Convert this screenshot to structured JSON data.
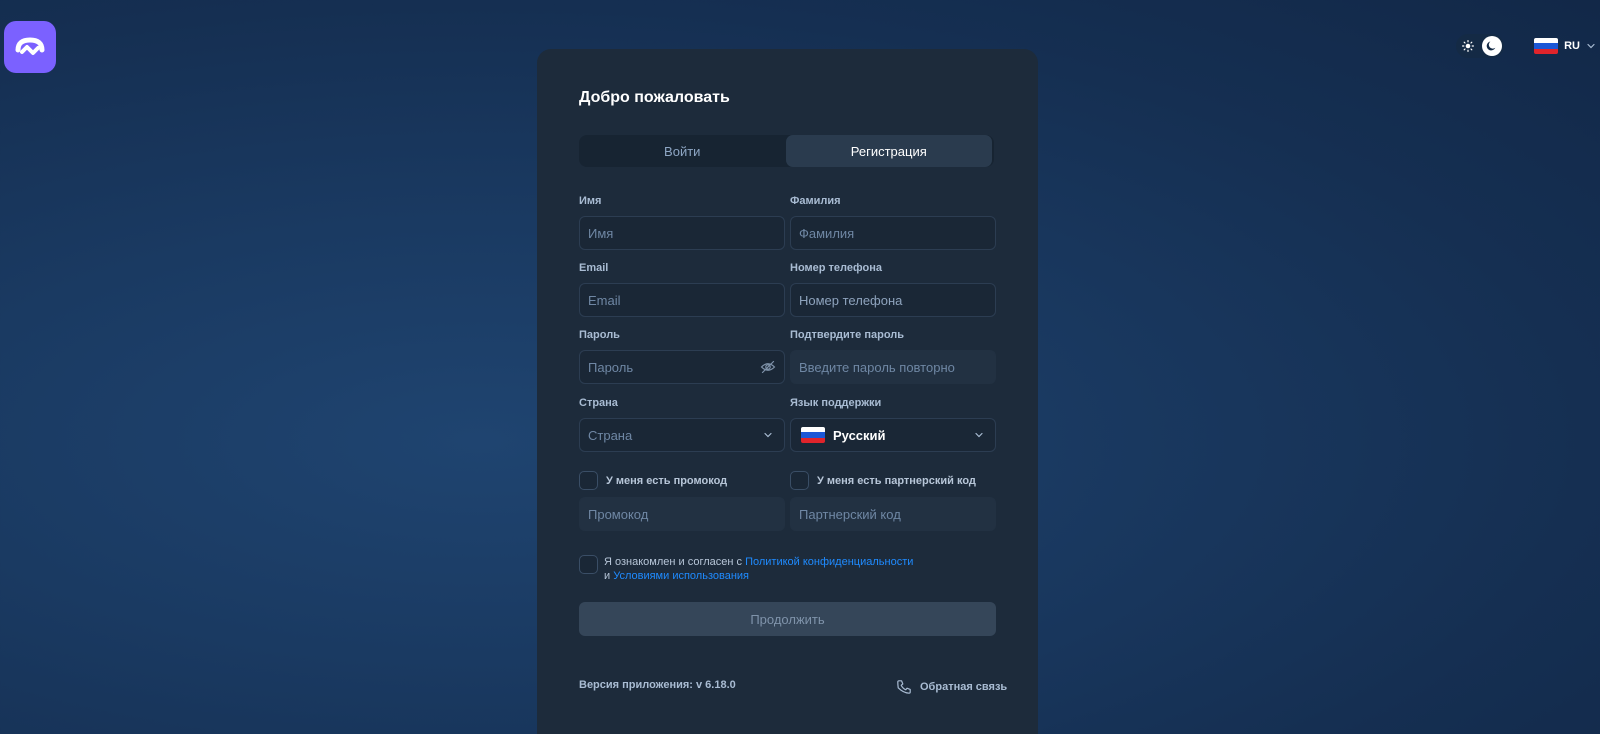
{
  "app": {
    "logo_icon": "app-logo-icon",
    "accent_color": "#7b61ff"
  },
  "topbar": {
    "theme_toggle": {
      "light_icon": "sun-icon",
      "dark_icon": "moon-icon",
      "active": "dark"
    },
    "language": {
      "code": "RU",
      "flag": "russia-flag-icon"
    }
  },
  "card": {
    "title": "Добро пожаловать",
    "tabs": [
      {
        "label": "Войти",
        "active": false
      },
      {
        "label": "Регистрация",
        "active": true
      }
    ],
    "fields": {
      "first_name": {
        "label": "Имя",
        "placeholder": "Имя",
        "value": ""
      },
      "last_name": {
        "label": "Фамилия",
        "placeholder": "Фамилия",
        "value": ""
      },
      "email": {
        "label": "Email",
        "placeholder": "Email",
        "value": ""
      },
      "phone": {
        "label": "Номер телефона",
        "placeholder": "Номер телефона",
        "value": ""
      },
      "password": {
        "label": "Пароль",
        "placeholder": "Пароль",
        "value": ""
      },
      "password_confirm": {
        "label": "Подтвердите пароль",
        "placeholder": "Введите пароль повторно",
        "value": ""
      },
      "country": {
        "label": "Страна",
        "placeholder": "Страна",
        "selected": ""
      },
      "support_language": {
        "label": "Язык поддержки",
        "selected": "Русский"
      },
      "promo_code": {
        "check_label": "У меня есть промокод",
        "checked": false,
        "placeholder": "Промокод"
      },
      "partner_code": {
        "check_label": "У меня есть партнерский код",
        "checked": false,
        "placeholder": "Партнерский код"
      }
    },
    "agreement": {
      "checked": false,
      "text_before": "Я ознакомлен и согласен с ",
      "privacy_link": "Политикой конфиденциальности",
      "text_middle": "и ",
      "terms_link": "Условиями использования"
    },
    "continue_button": "Продолжить",
    "version": "Версия приложения: v 6.18.0",
    "feedback": "Обратная связь"
  }
}
